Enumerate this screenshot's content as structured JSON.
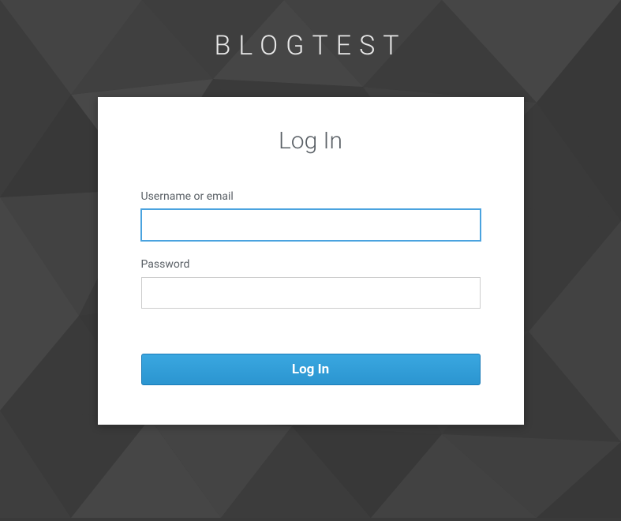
{
  "site": {
    "title": "BLOGTEST"
  },
  "login": {
    "heading": "Log In",
    "username_label": "Username or email",
    "username_value": "",
    "password_label": "Password",
    "password_value": "",
    "submit_label": "Log In"
  },
  "colors": {
    "accent": "#2b95d0",
    "background": "#3a3a3a",
    "card": "#ffffff",
    "text_muted": "#5a6066"
  }
}
